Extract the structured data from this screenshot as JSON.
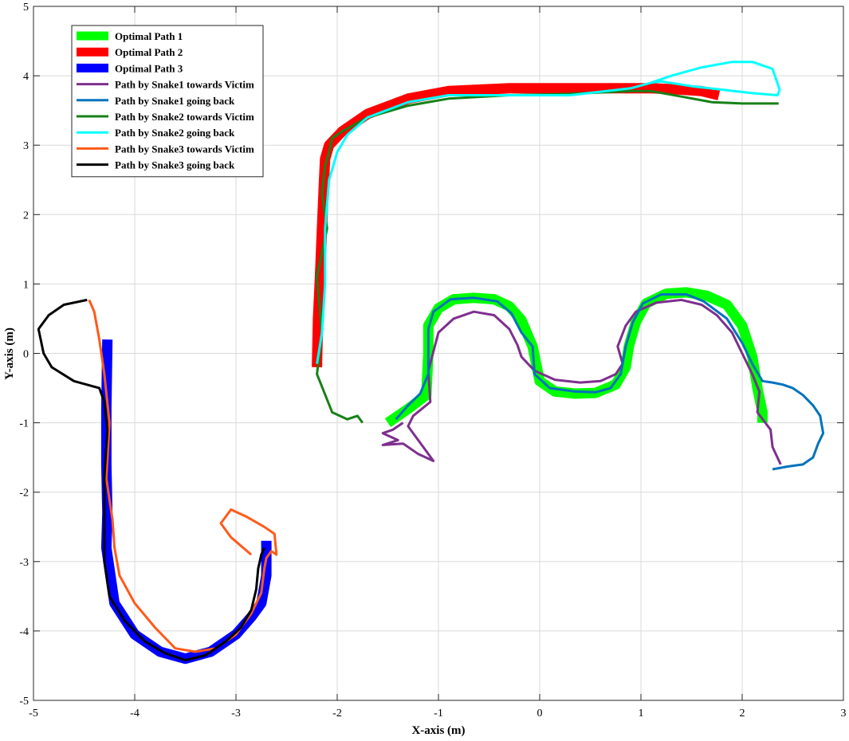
{
  "chart_data": {
    "type": "line",
    "title": "",
    "xlabel": "X-axis (m)",
    "ylabel": "Y-axis (m)",
    "xlim": [
      -5,
      3
    ],
    "ylim": [
      -5,
      5
    ],
    "xticks": [
      "-5",
      "-4",
      "-3",
      "-2",
      "-1",
      "0",
      "1",
      "2",
      "3"
    ],
    "yticks": [
      "-5",
      "-4",
      "-3",
      "-2",
      "-1",
      "0",
      "1",
      "2",
      "3",
      "4",
      "5"
    ],
    "grid": true,
    "legend_position": "top-left",
    "series": [
      {
        "name": "Optimal Path 1",
        "color": "#00ff00",
        "style": "thick",
        "x": [
          -1.5,
          -1.3,
          -1.12,
          -1.1,
          -1.1,
          -1.0,
          -0.85,
          -0.65,
          -0.45,
          -0.3,
          -0.18,
          -0.07,
          0.0,
          0.15,
          0.35,
          0.55,
          0.75,
          0.85,
          0.88,
          0.95,
          1.05,
          1.25,
          1.45,
          1.65,
          1.85,
          2.0,
          2.1,
          2.15,
          2.2,
          2.2
        ],
        "y": [
          -1.0,
          -0.8,
          -0.6,
          0.0,
          0.4,
          0.65,
          0.78,
          0.8,
          0.78,
          0.68,
          0.48,
          0.1,
          -0.4,
          -0.55,
          -0.58,
          -0.57,
          -0.45,
          -0.2,
          0.1,
          0.45,
          0.72,
          0.86,
          0.88,
          0.83,
          0.7,
          0.4,
          -0.05,
          -0.5,
          -0.85,
          -1.0
        ]
      },
      {
        "name": "Optimal Path 2",
        "color": "#ff0000",
        "style": "thick",
        "x": [
          -2.2,
          -2.19,
          -2.17,
          -2.15,
          -2.13,
          -2.12,
          -2.08,
          -1.95,
          -1.7,
          -1.3,
          -0.9,
          -0.3,
          0.3,
          0.9,
          1.1,
          1.4,
          1.6,
          1.77
        ],
        "y": [
          -0.2,
          0.5,
          1.1,
          1.8,
          2.5,
          2.8,
          3.0,
          3.2,
          3.45,
          3.67,
          3.78,
          3.82,
          3.82,
          3.82,
          3.82,
          3.8,
          3.78,
          3.72
        ]
      },
      {
        "name": "Optimal Path 3",
        "color": "#0000ff",
        "style": "thick",
        "x": [
          -4.27,
          -4.28,
          -4.28,
          -4.27,
          -4.28,
          -4.2,
          -4.0,
          -3.75,
          -3.5,
          -3.25,
          -3.0,
          -2.85,
          -2.75,
          -2.7,
          -2.7
        ],
        "y": [
          0.2,
          -0.8,
          -1.6,
          -2.3,
          -2.8,
          -3.6,
          -4.05,
          -4.3,
          -4.4,
          -4.3,
          -4.05,
          -3.8,
          -3.6,
          -3.2,
          -2.7
        ]
      },
      {
        "name": "Path by Snake1 towards Victim",
        "color": "#7e2f8e",
        "style": "thin",
        "x": [
          -1.35,
          -1.45,
          -1.55,
          -1.4,
          -1.55,
          -1.35,
          -1.2,
          -1.05,
          -1.15,
          -1.3,
          -1.25,
          -1.08,
          -1.1,
          -1.0,
          -0.85,
          -0.65,
          -0.45,
          -0.3,
          -0.22,
          -0.18,
          -0.05,
          0.15,
          0.4,
          0.6,
          0.75,
          0.82,
          0.77,
          0.85,
          0.95,
          1.15,
          1.4,
          1.6,
          1.75,
          1.9,
          2.0,
          2.1,
          2.17,
          2.15,
          2.28,
          2.3,
          2.38
        ],
        "y": [
          -1.0,
          -1.1,
          -1.15,
          -1.25,
          -1.32,
          -1.3,
          -1.45,
          -1.55,
          -1.35,
          -1.05,
          -0.9,
          -0.7,
          -0.25,
          0.3,
          0.5,
          0.6,
          0.55,
          0.35,
          0.12,
          -0.05,
          -0.25,
          -0.38,
          -0.42,
          -0.4,
          -0.3,
          -0.15,
          0.1,
          0.4,
          0.6,
          0.73,
          0.77,
          0.7,
          0.55,
          0.3,
          0.0,
          -0.3,
          -0.55,
          -0.85,
          -1.1,
          -1.35,
          -1.6
        ]
      },
      {
        "name": "Path by Snake1 going back",
        "color": "#0072bd",
        "style": "thin",
        "x": [
          -1.42,
          -1.3,
          -1.18,
          -1.1,
          -1.1,
          -1.05,
          -0.88,
          -0.65,
          -0.42,
          -0.28,
          -0.18,
          -0.07,
          -0.05,
          0.1,
          0.35,
          0.55,
          0.7,
          0.8,
          0.85,
          0.92,
          1.02,
          1.2,
          1.45,
          1.62,
          1.85,
          2.0,
          2.1,
          2.2,
          2.3,
          2.4,
          2.5,
          2.6,
          2.7,
          2.77,
          2.8,
          2.75,
          2.7,
          2.6,
          2.45,
          2.3
        ],
        "y": [
          -0.95,
          -0.75,
          -0.58,
          -0.3,
          0.35,
          0.6,
          0.78,
          0.8,
          0.75,
          0.58,
          0.3,
          0.1,
          -0.3,
          -0.5,
          -0.55,
          -0.56,
          -0.5,
          -0.3,
          0.1,
          0.45,
          0.72,
          0.85,
          0.85,
          0.75,
          0.5,
          0.15,
          -0.15,
          -0.4,
          -0.42,
          -0.45,
          -0.5,
          -0.6,
          -0.75,
          -0.9,
          -1.15,
          -1.3,
          -1.5,
          -1.6,
          -1.63,
          -1.67
        ]
      },
      {
        "name": "Path by Snake2 towards Victim",
        "color": "#178117",
        "style": "thin",
        "x": [
          -1.75,
          -1.8,
          -1.9,
          -2.05,
          -2.2,
          -2.15,
          -2.2,
          -2.1,
          -2.15,
          -2.12,
          -2.08,
          -2.05,
          -1.95,
          -1.7,
          -1.3,
          -0.9,
          -0.3,
          0.3,
          0.9,
          1.1,
          1.4,
          1.7,
          2.0,
          2.36
        ],
        "y": [
          -1.0,
          -0.9,
          -0.95,
          -0.85,
          -0.3,
          0.3,
          1.1,
          1.8,
          2.3,
          2.7,
          2.9,
          3.1,
          3.2,
          3.4,
          3.57,
          3.67,
          3.72,
          3.74,
          3.78,
          3.78,
          3.7,
          3.62,
          3.6,
          3.6
        ]
      },
      {
        "name": "Path by Snake2 going back",
        "color": "#00ffff",
        "style": "thin",
        "x": [
          -2.2,
          -2.15,
          -2.12,
          -2.12,
          -2.08,
          -2.0,
          -1.9,
          -1.7,
          -1.3,
          -0.9,
          -0.3,
          0.3,
          0.9,
          1.1,
          1.3,
          1.6,
          1.9,
          2.1,
          2.3,
          2.37,
          2.35,
          2.1,
          1.8,
          1.5,
          1.2,
          1.1
        ],
        "y": [
          -0.15,
          0.3,
          1.0,
          1.8,
          2.5,
          2.9,
          3.15,
          3.4,
          3.62,
          3.72,
          3.72,
          3.72,
          3.82,
          3.9,
          4.0,
          4.12,
          4.2,
          4.2,
          4.1,
          3.8,
          3.72,
          3.75,
          3.8,
          3.85,
          3.92,
          3.9
        ]
      },
      {
        "name": "Path by Snake3 towards Victim",
        "color": "#ff5a19",
        "style": "thin",
        "x": [
          -4.45,
          -4.4,
          -4.35,
          -4.3,
          -4.25,
          -4.28,
          -4.22,
          -4.2,
          -4.15,
          -4.0,
          -3.8,
          -3.6,
          -3.4,
          -3.2,
          -3.0,
          -2.85,
          -2.75,
          -2.72,
          -2.7,
          -2.65,
          -2.6,
          -2.62,
          -2.72,
          -2.9,
          -3.05,
          -3.15,
          -3.05,
          -2.85
        ],
        "y": [
          0.77,
          0.6,
          0.2,
          -0.3,
          -1.0,
          -1.8,
          -2.4,
          -2.8,
          -3.2,
          -3.6,
          -3.95,
          -4.25,
          -4.3,
          -4.25,
          -4.05,
          -3.75,
          -3.45,
          -3.1,
          -2.95,
          -2.85,
          -2.9,
          -2.6,
          -2.5,
          -2.35,
          -2.25,
          -2.45,
          -2.65,
          -2.9
        ]
      },
      {
        "name": "Path by Snake3 going back",
        "color": "#000000",
        "style": "thin",
        "x": [
          -4.47,
          -4.7,
          -4.85,
          -4.95,
          -4.9,
          -4.82,
          -4.6,
          -4.35,
          -4.3,
          -4.27,
          -4.3,
          -4.3,
          -4.3,
          -4.25,
          -4.1,
          -3.9,
          -3.7,
          -3.5,
          -3.3,
          -3.1,
          -2.95,
          -2.85,
          -2.8,
          -2.78,
          -2.75,
          -2.72
        ],
        "y": [
          0.77,
          0.7,
          0.55,
          0.35,
          0.0,
          -0.2,
          -0.4,
          -0.5,
          -0.7,
          -1.1,
          -1.8,
          -2.4,
          -3.0,
          -3.5,
          -3.85,
          -4.15,
          -4.32,
          -4.42,
          -4.35,
          -4.15,
          -3.95,
          -3.7,
          -3.4,
          -3.1,
          -2.9,
          -2.8
        ]
      }
    ]
  }
}
